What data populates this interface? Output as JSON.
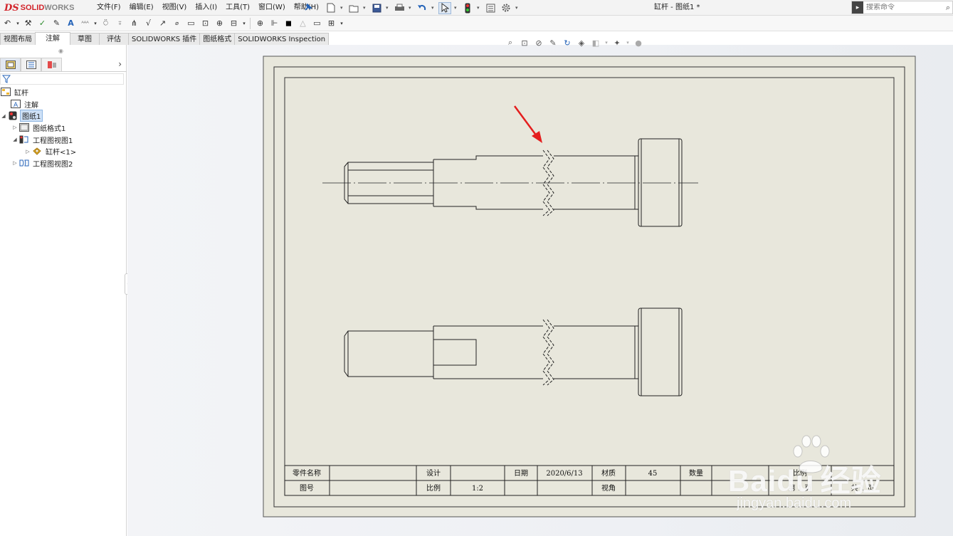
{
  "app": {
    "brand_ds": "DS",
    "brand_solid": "SOLID",
    "brand_works": "WORKS"
  },
  "menu": [
    "文件(F)",
    "编辑(E)",
    "视图(V)",
    "插入(I)",
    "工具(T)",
    "窗口(W)",
    "帮助(H)"
  ],
  "document_title": "缸杆 - 图纸1 *",
  "search": {
    "placeholder": "搜索命令"
  },
  "command_tabs": [
    {
      "label": "视图布局",
      "active": false
    },
    {
      "label": "注解",
      "active": true
    },
    {
      "label": "草图",
      "active": false
    },
    {
      "label": "评估",
      "active": false
    },
    {
      "label": "SOLIDWORKS 插件",
      "active": false
    },
    {
      "label": "图纸格式",
      "active": false
    },
    {
      "label": "SOLIDWORKS Inspection",
      "active": false
    }
  ],
  "tree": {
    "root": "缸杆",
    "annotations": "注解",
    "sheet": "图纸1",
    "sheet_format": "图纸格式1",
    "view1": "工程图视图1",
    "part": "缸杆<1>",
    "view2": "工程图视图2"
  },
  "title_block": {
    "r1": [
      "零件名称",
      "",
      "设计",
      "",
      "日期",
      "2020/6/13",
      "材质",
      "45",
      "数量",
      "",
      "比例",
      ""
    ],
    "r2": [
      "图号",
      "",
      "比例",
      "1:2",
      "",
      "",
      "视角",
      "",
      "",
      "",
      "第  1  页",
      "共  1  页"
    ]
  },
  "watermark": {
    "main": "Bai",
    "paw": "du",
    "suffix": "经验",
    "url": "jingyan.baidu.com"
  },
  "colors": {
    "sheet_bg": "#e8e7dc",
    "accent_red": "#e41e1e",
    "selection": "#cde0f6"
  }
}
